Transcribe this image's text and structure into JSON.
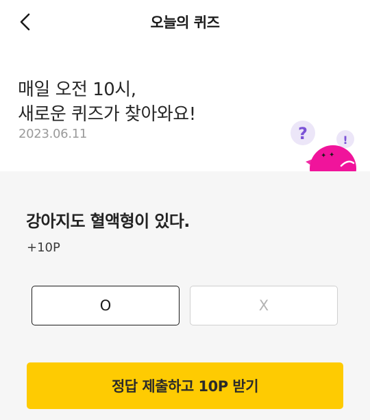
{
  "header": {
    "back_icon": "chevron-left-icon",
    "title": "오늘의 퀴즈"
  },
  "hero": {
    "line1": "매일 오전 10시,",
    "line2": "새로운 퀴즈가 찾아와요!",
    "date": "2023.06.11",
    "mascot_question_mark": "?",
    "mascot_exclamation_mark": "!"
  },
  "quiz": {
    "question": "강아지도 혈액형이 있다.",
    "points": "+10P",
    "options": [
      {
        "label": "O",
        "selected": true
      },
      {
        "label": "X",
        "selected": false
      }
    ],
    "submit_label": "정답 제출하고 10P 받기"
  },
  "colors": {
    "accent": "#fecb02",
    "panel_bg": "#f6f6f6",
    "mascot_pink": "#f0149b",
    "mascot_purple": "#7b52d6"
  }
}
